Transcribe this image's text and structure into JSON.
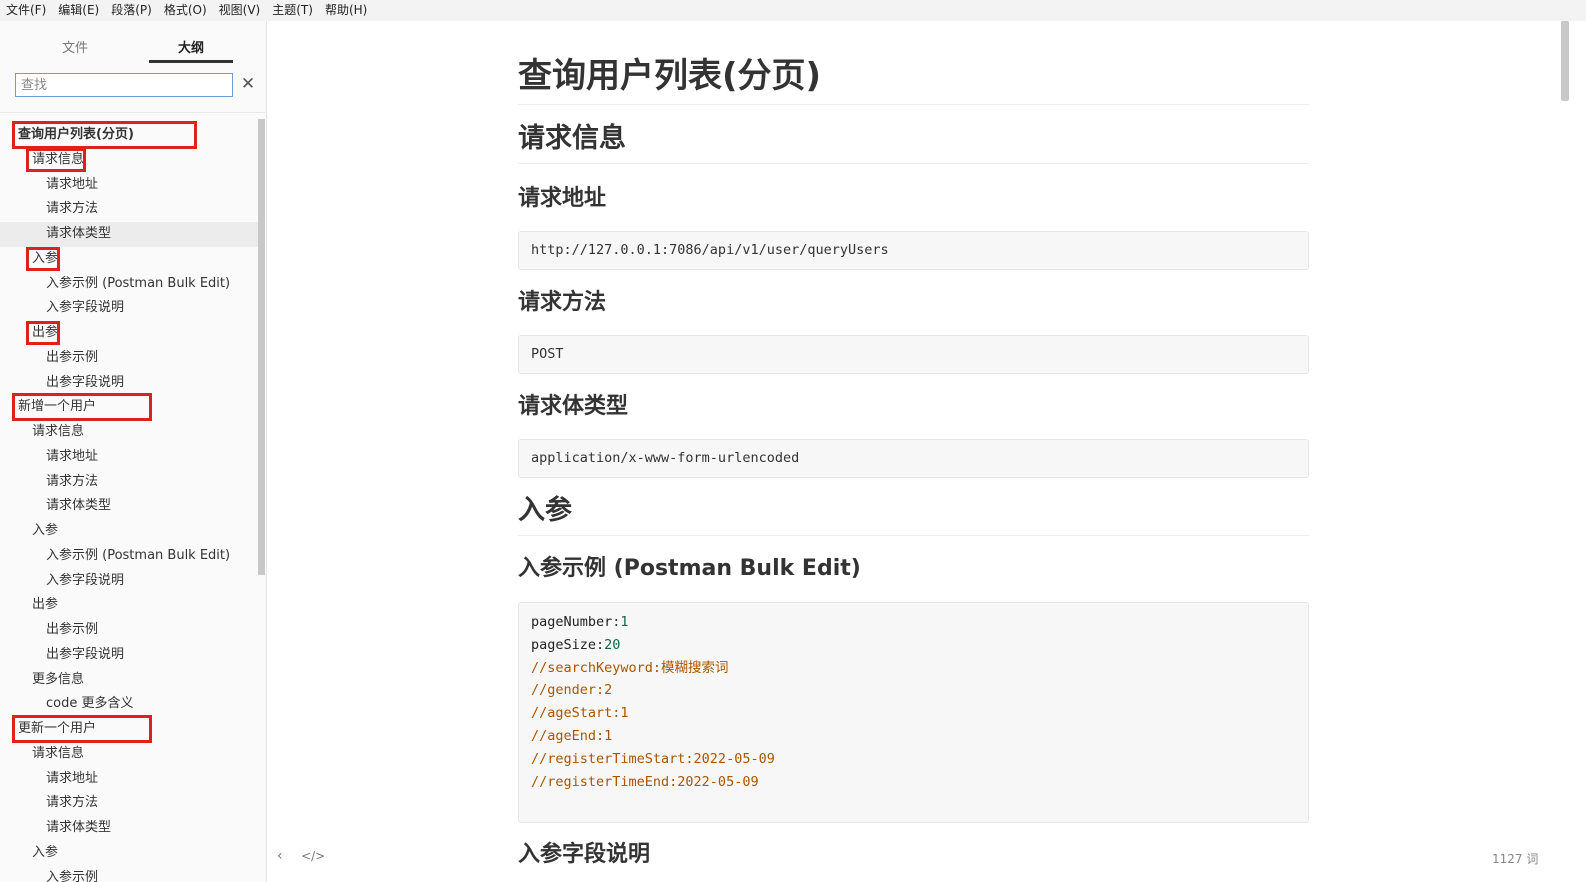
{
  "menu": [
    {
      "label": "文件(F)"
    },
    {
      "label": "编辑(E)"
    },
    {
      "label": "段落(P)"
    },
    {
      "label": "格式(O)"
    },
    {
      "label": "视图(V)"
    },
    {
      "label": "主题(T)"
    },
    {
      "label": "帮助(H)"
    }
  ],
  "sidebar": {
    "tabs": {
      "files": "文件",
      "outline": "大纲"
    },
    "search_placeholder": "查找",
    "close_icon": "✕",
    "annotation_color": "#e0201c",
    "outline": [
      {
        "label": "查询用户列表(分页)",
        "level": 1,
        "bold": true,
        "annotated": true
      },
      {
        "label": "请求信息",
        "level": 2,
        "annotated": true
      },
      {
        "label": "请求地址",
        "level": 3
      },
      {
        "label": "请求方法",
        "level": 3
      },
      {
        "label": "请求体类型",
        "level": 3,
        "active": true
      },
      {
        "label": "入参",
        "level": 2,
        "annotated": true
      },
      {
        "label": "入参示例 (Postman Bulk Edit)",
        "level": 3
      },
      {
        "label": "入参字段说明",
        "level": 3
      },
      {
        "label": "出参",
        "level": 2,
        "annotated": true
      },
      {
        "label": "出参示例",
        "level": 3
      },
      {
        "label": "出参字段说明",
        "level": 3
      },
      {
        "label": "新增一个用户",
        "level": 1,
        "annotated": true
      },
      {
        "label": "请求信息",
        "level": 2
      },
      {
        "label": "请求地址",
        "level": 3
      },
      {
        "label": "请求方法",
        "level": 3
      },
      {
        "label": "请求体类型",
        "level": 3
      },
      {
        "label": "入参",
        "level": 2
      },
      {
        "label": "入参示例 (Postman Bulk Edit)",
        "level": 3
      },
      {
        "label": "入参字段说明",
        "level": 3
      },
      {
        "label": "出参",
        "level": 2
      },
      {
        "label": "出参示例",
        "level": 3
      },
      {
        "label": "出参字段说明",
        "level": 3
      },
      {
        "label": "更多信息",
        "level": 2
      },
      {
        "label": "code 更多含义",
        "level": 3
      },
      {
        "label": "更新一个用户",
        "level": 1,
        "annotated": true
      },
      {
        "label": "请求信息",
        "level": 2
      },
      {
        "label": "请求地址",
        "level": 3
      },
      {
        "label": "请求方法",
        "level": 3
      },
      {
        "label": "请求体类型",
        "level": 3
      },
      {
        "label": "入参",
        "level": 2
      },
      {
        "label": "入参示例",
        "level": 3
      }
    ],
    "footer": {
      "back_icon": "‹",
      "source_icon": "</>"
    }
  },
  "document": {
    "title": "查询用户列表(分页)",
    "h_request_info": "请求信息",
    "h_request_url": "请求地址",
    "request_url": "http://127.0.0.1:7086/api/v1/user/queryUsers",
    "h_request_method": "请求方法",
    "request_method": "POST",
    "h_body_type": "请求体类型",
    "body_type": "application/x-www-form-urlencoded",
    "h_params": "入参",
    "h_params_example": "入参示例 (Postman Bulk Edit)",
    "params_code": [
      {
        "key": "pageNumber",
        "sep": ":",
        "val": "1",
        "comment": false
      },
      {
        "key": "pageSize",
        "sep": ":",
        "val": "20",
        "comment": false
      },
      {
        "text": "//searchKeyword:模糊搜索词",
        "comment": true
      },
      {
        "text": "//gender:2",
        "comment": true
      },
      {
        "text": "//ageStart:1",
        "comment": true
      },
      {
        "text": "//ageEnd:1",
        "comment": true
      },
      {
        "text": "//registerTimeStart:2022-05-09",
        "comment": true
      },
      {
        "text": "//registerTimeEnd:2022-05-09",
        "comment": true
      }
    ],
    "h_params_fields": "入参字段说明"
  },
  "status": {
    "word_count": "1127 词"
  }
}
